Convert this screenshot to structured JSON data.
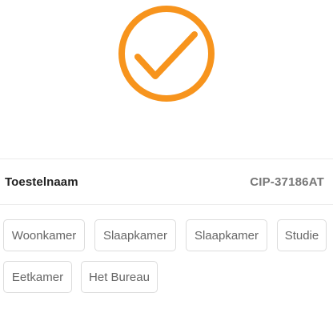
{
  "colors": {
    "accent": "#f7941d",
    "divider": "#ececec",
    "tag_border": "#dcdcdc",
    "label_text": "#222222",
    "value_text": "#777777",
    "tag_text": "#666666"
  },
  "status_icon": "check-circle-icon",
  "device": {
    "label": "Toestelnaam",
    "value": "CIP-37186AT"
  },
  "rooms": [
    "Woonkamer",
    "Slaapkamer",
    "Slaapkamer",
    "Studie",
    "Eetkamer",
    "Het Bureau"
  ]
}
